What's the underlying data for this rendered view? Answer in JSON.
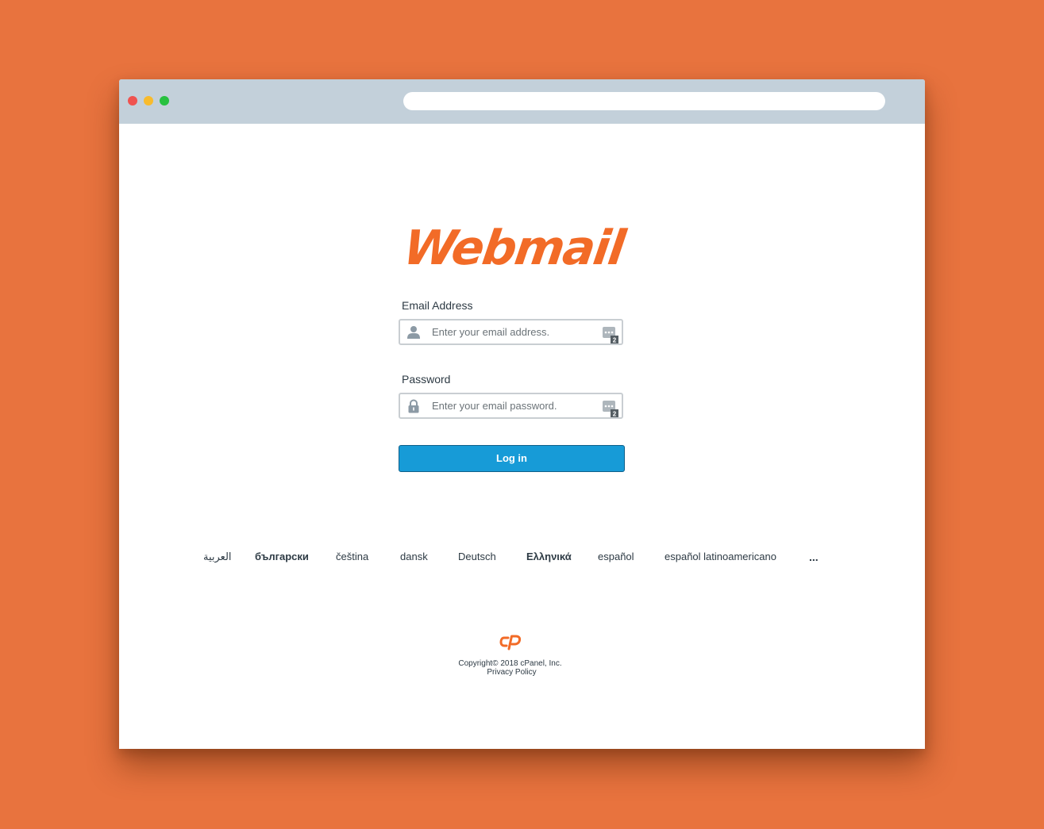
{
  "logo": {
    "text": "Webmail",
    "color": "#f26b27"
  },
  "login_form": {
    "email_label": "Email Address",
    "email_placeholder": "Enter your email address.",
    "email_value": "",
    "email_icon": "user-icon",
    "password_label": "Password",
    "password_placeholder": "Enter your email password.",
    "password_value": "",
    "password_icon": "lock-icon",
    "password_manager_icon": "password-manager-icon",
    "password_manager_badge": "2",
    "login_button_label": "Log in",
    "button_color": "#179bd7"
  },
  "languages": {
    "items": [
      {
        "label": "العربية",
        "bold": false
      },
      {
        "label": "български",
        "bold": true
      },
      {
        "label": "čeština",
        "bold": false
      },
      {
        "label": "dansk",
        "bold": false
      },
      {
        "label": "Deutsch",
        "bold": false
      },
      {
        "label": "Ελληνικά",
        "bold": true
      },
      {
        "label": "español",
        "bold": false
      },
      {
        "label": "español latinoamericano",
        "bold": false
      }
    ],
    "more_label": "..."
  },
  "footer": {
    "brand_icon": "cpanel-logo-icon",
    "copyright": "Copyright© 2018 cPanel, Inc.",
    "privacy_link": "Privacy Policy"
  },
  "colors": {
    "page_background": "#e8733e",
    "titlebar": "#c3d0da",
    "brand_orange": "#f26b27"
  }
}
